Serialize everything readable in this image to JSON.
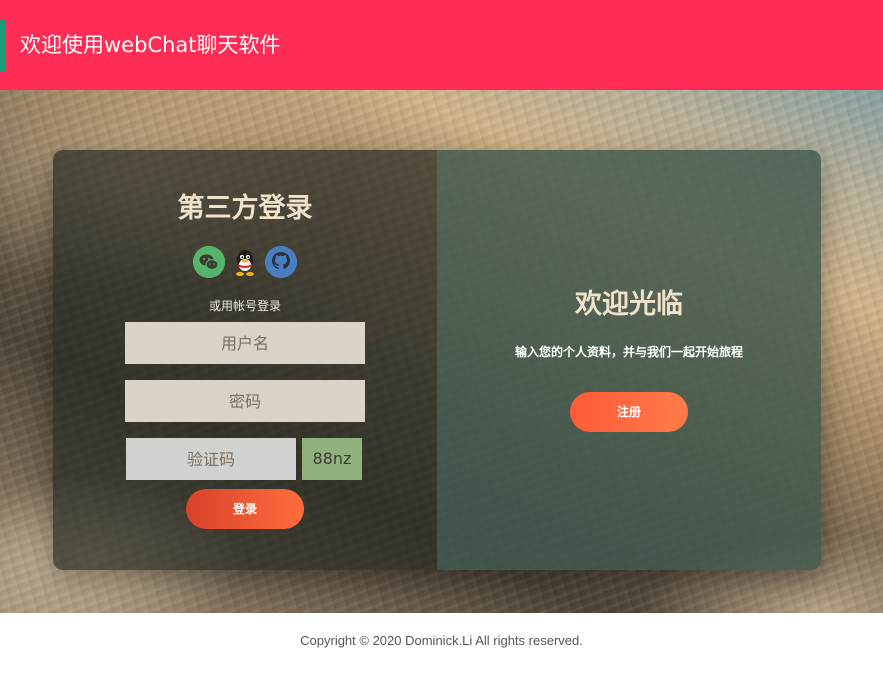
{
  "header": {
    "title": "欢迎使用webChat聊天软件",
    "background_color": "#ff2d55",
    "accent_color": "#1a9c79"
  },
  "login": {
    "title": "第三方登录",
    "social_icons": [
      "wechat-icon",
      "qq-icon",
      "github-icon"
    ],
    "alt_login_text": "或用帐号登录",
    "username_placeholder": "用户名",
    "password_placeholder": "密码",
    "captcha_placeholder": "验证码",
    "captcha_code": "88nz",
    "login_button": "登录"
  },
  "welcome": {
    "title": "欢迎光临",
    "subtitle": "输入您的个人资料，并与我们一起开始旅程",
    "register_button": "注册"
  },
  "footer": {
    "copyright": "Copyright © 2020 Dominick.Li All rights reserved."
  }
}
